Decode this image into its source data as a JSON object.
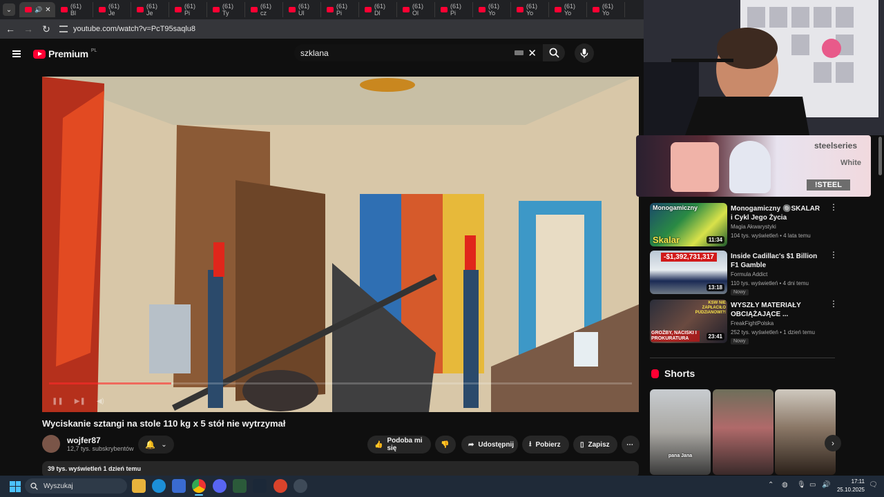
{
  "browser": {
    "tabs": [
      {
        "label": "(61) Bl"
      },
      {
        "label": "(61) Je"
      },
      {
        "label": "(61) Je"
      },
      {
        "label": "(61) Pi"
      },
      {
        "label": "(61) Ty"
      },
      {
        "label": "(61) cz"
      },
      {
        "label": "(61) Ul"
      },
      {
        "label": "(61) Pi"
      },
      {
        "label": "(61) Dl"
      },
      {
        "label": "(61) Ol"
      },
      {
        "label": "(61) Pi"
      },
      {
        "label": "(61) Yo"
      },
      {
        "label": "(61) Yo"
      },
      {
        "label": "(61) Yo"
      },
      {
        "label": "(61) Yo"
      }
    ],
    "url": "youtube.com/watch?v=PcT95saqlu8"
  },
  "masthead": {
    "logo_text": "Premium",
    "logo_region": "PL",
    "search_query": "szklana"
  },
  "video": {
    "title": "Wyciskanie sztangi na stole 110 kg x 5 stół nie wytrzymał",
    "progress_fraction": 0.21,
    "channel": "wojfer87",
    "subscribers": "12,7 tys. subskrybentów",
    "actions": {
      "like": "Podoba mi się",
      "share": "Udostępnij",
      "download": "Pobierz",
      "save": "Zapisz"
    },
    "description_meta": "39 tys. wyświetleń  1 dzień temu"
  },
  "ad": {
    "brand": "steelseries",
    "variant": "White",
    "tag": "!STEEL"
  },
  "recommendations": [
    {
      "title": "Monogamiczny 🔘SKALAR i Cykl Jego Życia",
      "channel": "Magia Akwarystyki",
      "views": "104 tys. wyświetleń • 4 lata temu",
      "duration": "11:34",
      "badge": "",
      "thumb_text": "Skalar",
      "thumb_top": "Monogamiczny"
    },
    {
      "title": "Inside Cadillac's $1 Billion F1 Gamble",
      "channel": "Formula Addict",
      "views": "110 tys. wyświetleń • 4 dni temu",
      "duration": "13:18",
      "badge": "Nowy",
      "thumb_text": "-$1,392,731,317",
      "thumb_top": ""
    },
    {
      "title": "WYSZŁY MATERIAŁY OBCIĄŻAJĄCE ...",
      "channel": "FreakFightPolska",
      "views": "252 tys. wyświetleń • 1 dzień temu",
      "duration": "23:41",
      "badge": "Nowy",
      "thumb_text": "GROŹBY, NACISKI I PROKURATURA",
      "thumb_top": "KSW NIE ZAPŁACIŁO PUDZIANOWI?!"
    }
  ],
  "shorts": {
    "heading": "Shorts",
    "items": [
      {
        "caption": "pana Jana"
      },
      {
        "caption": ""
      },
      {
        "caption": ""
      }
    ]
  },
  "taskbar": {
    "search_placeholder": "Wyszukaj",
    "time": "17:11",
    "date": "25.10.2025"
  }
}
